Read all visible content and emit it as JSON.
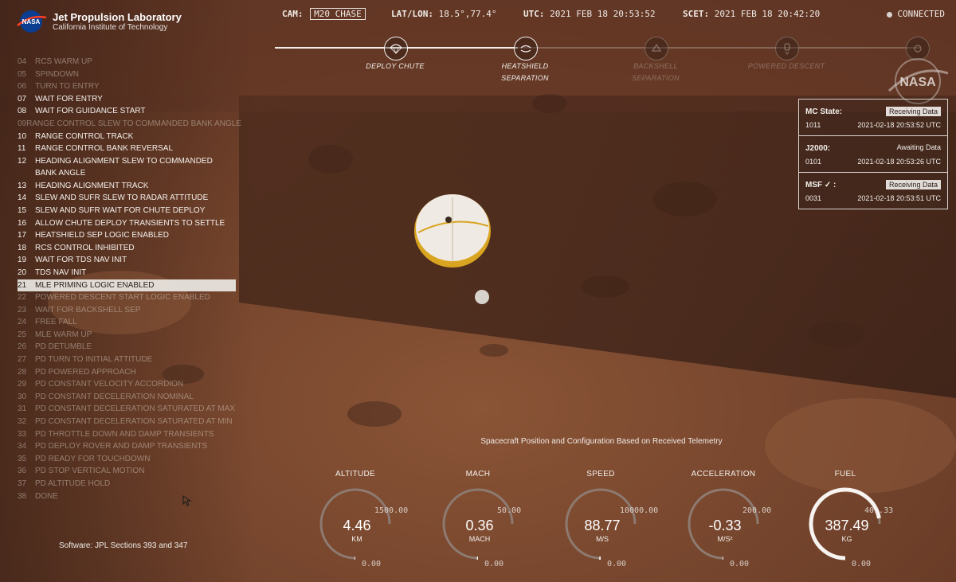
{
  "logo": {
    "title": "Jet Propulsion Laboratory",
    "subtitle": "California Institute of Technology",
    "badge_text": "NASA"
  },
  "topbar": {
    "cam_label": "CAM:",
    "cam_value": "M20 CHASE",
    "latlon_label": "LAT/LON:",
    "latlon_value": "18.5°,77.4°",
    "utc_label": "UTC:",
    "utc_value": "2021 FEB 18 20:53:52",
    "scet_label": "SCET:",
    "scet_value": "2021 FEB 18 20:42:20",
    "connection": "CONNECTED"
  },
  "timeline": [
    {
      "label": "DEPLOY CHUTE",
      "icon": "parachute-icon",
      "done": true
    },
    {
      "label": "HEATSHIELD SEPARATION",
      "icon": "heatshield-icon",
      "done": true
    },
    {
      "label": "BACKSHELL SEPARATION",
      "icon": "backshell-icon",
      "done": false
    },
    {
      "label": "POWERED DESCENT",
      "icon": "powered-descent-icon",
      "done": false
    },
    {
      "label": "",
      "icon": "touchdown-icon",
      "done": false
    }
  ],
  "steps": [
    {
      "n": "04",
      "label": "RCS WARM UP",
      "state": "dim"
    },
    {
      "n": "05",
      "label": "SPINDOWN",
      "state": "dim"
    },
    {
      "n": "06",
      "label": "TURN TO ENTRY",
      "state": "dim"
    },
    {
      "n": "07",
      "label": "WAIT FOR ENTRY",
      "state": "bright"
    },
    {
      "n": "08",
      "label": "WAIT FOR GUIDANCE START",
      "state": "bright"
    },
    {
      "n": "09",
      "label": "RANGE CONTROL SLEW TO COMMANDED BANK ANGLE",
      "state": "dim"
    },
    {
      "n": "10",
      "label": "RANGE CONTROL TRACK",
      "state": "bright"
    },
    {
      "n": "11",
      "label": "RANGE CONTROL BANK REVERSAL",
      "state": "bright"
    },
    {
      "n": "12",
      "label": "HEADING ALIGNMENT SLEW TO COMMANDED BANK ANGLE",
      "state": "bright",
      "wrap": true
    },
    {
      "n": "13",
      "label": "HEADING ALIGNMENT TRACK",
      "state": "bright"
    },
    {
      "n": "14",
      "label": "SLEW AND SUFR SLEW TO RADAR ATTITUDE",
      "state": "bright"
    },
    {
      "n": "15",
      "label": "SLEW AND SUFR WAIT FOR CHUTE DEPLOY",
      "state": "bright"
    },
    {
      "n": "16",
      "label": "ALLOW CHUTE DEPLOY TRANSIENTS TO SETTLE",
      "state": "bright"
    },
    {
      "n": "17",
      "label": "HEATSHIELD SEP LOGIC ENABLED",
      "state": "bright"
    },
    {
      "n": "18",
      "label": "RCS CONTROL INHIBITED",
      "state": "bright"
    },
    {
      "n": "19",
      "label": "WAIT FOR TDS NAV INIT",
      "state": "bright"
    },
    {
      "n": "20",
      "label": "TDS NAV INIT",
      "state": "bright"
    },
    {
      "n": "21",
      "label": "MLE PRIMING LOGIC ENABLED",
      "state": "active"
    },
    {
      "n": "22",
      "label": "POWERED DESCENT START LOGIC ENABLED",
      "state": "dim"
    },
    {
      "n": "23",
      "label": "WAIT FOR BACKSHELL SEP",
      "state": "dim"
    },
    {
      "n": "24",
      "label": "FREE FALL",
      "state": "dim"
    },
    {
      "n": "25",
      "label": "MLE WARM UP",
      "state": "dim"
    },
    {
      "n": "26",
      "label": "PD DETUMBLE",
      "state": "dim"
    },
    {
      "n": "27",
      "label": "PD TURN TO INITIAL ATTITUDE",
      "state": "dim"
    },
    {
      "n": "28",
      "label": "PD POWERED APPROACH",
      "state": "dim"
    },
    {
      "n": "29",
      "label": "PD CONSTANT VELOCITY ACCORDION",
      "state": "dim"
    },
    {
      "n": "30",
      "label": "PD CONSTANT DECELERATION NOMINAL",
      "state": "dim"
    },
    {
      "n": "31",
      "label": "PD CONSTANT DECELERATION SATURATED AT MAX",
      "state": "dim"
    },
    {
      "n": "32",
      "label": "PD CONSTANT DECELERATION SATURATED AT MIN",
      "state": "dim"
    },
    {
      "n": "33",
      "label": "PD THROTTLE DOWN AND DAMP TRANSIENTS",
      "state": "dim"
    },
    {
      "n": "34",
      "label": "PD DEPLOY ROVER AND DAMP TRANSIENTS",
      "state": "dim"
    },
    {
      "n": "35",
      "label": "PD READY FOR TOUCHDOWN",
      "state": "dim"
    },
    {
      "n": "36",
      "label": "PD STOP VERTICAL MOTION",
      "state": "dim"
    },
    {
      "n": "37",
      "label": "PD ALTITUDE HOLD",
      "state": "dim"
    },
    {
      "n": "38",
      "label": "DONE",
      "state": "dim"
    }
  ],
  "software": "Software: JPL Sections 393 and 347",
  "state_panel": [
    {
      "title": "MC State:",
      "status": "Receiving Data",
      "boxed": true,
      "code": "1011",
      "time": "2021-02-18 20:53:52 UTC"
    },
    {
      "title": "J2000:",
      "status": "Awaiting Data",
      "boxed": false,
      "code": "0101",
      "time": "2021-02-18 20:53:26 UTC"
    },
    {
      "title": "MSF ✓ :",
      "status": "Receiving Data",
      "boxed": true,
      "code": "0031",
      "time": "2021-02-18 20:53:51 UTC"
    }
  ],
  "telemetry_title": "Spacecraft Position and Configuration Based on Received Telemetry",
  "gauges": [
    {
      "name": "altitude",
      "label": "ALTITUDE",
      "value": "4.46",
      "unit": "KM",
      "max": "1500.00",
      "min": "0.00",
      "fraction": 0.003
    },
    {
      "name": "mach",
      "label": "MACH",
      "value": "0.36",
      "unit": "MACH",
      "max": "50.00",
      "min": "0.00",
      "fraction": 0.007
    },
    {
      "name": "speed",
      "label": "SPEED",
      "value": "88.77",
      "unit": "M/S",
      "max": "10000.00",
      "min": "0.00",
      "fraction": 0.009
    },
    {
      "name": "acceleration",
      "label": "ACCELERATION",
      "value": "-0.33",
      "unit": "M/S²",
      "max": "200.00",
      "min": "0.00",
      "fraction": 0.0
    },
    {
      "name": "fuel",
      "label": "FUEL",
      "value": "387.49",
      "unit": "KG",
      "max": "401.33",
      "min": "0.00",
      "fraction": 0.965
    }
  ],
  "colors": {
    "terrain": "#6b3e27",
    "shadow": "#3b2218",
    "parachute": "#efeae4",
    "parachute_rim": "#d9a420",
    "gauge_track": "#8d7a70",
    "gauge_fill": "#f6f3f0"
  }
}
